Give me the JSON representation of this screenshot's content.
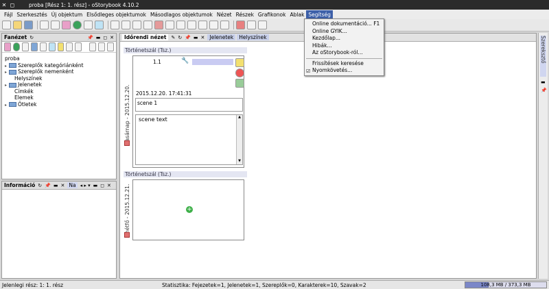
{
  "window": {
    "title": "proba [Rész 1: 1. rész] - oStorybook 4.10.2",
    "close_glyph": "✕",
    "restore_glyph": "◻"
  },
  "menubar": [
    "Fájl",
    "Szerkesztés",
    "Új objektum",
    "Elsődleges objektumok",
    "Másodlagos objektumok",
    "Nézet",
    "Részek",
    "Grafikonok",
    "Ablak",
    "Segítség"
  ],
  "help_menu": {
    "items": [
      "Online dokumentáció... F1",
      "Online GYIK...",
      "Kezdőlap...",
      "Hibák...",
      "Az oStorybook-ról..."
    ],
    "items2": [
      "Frissítések keresése",
      "Nyomkövetés..."
    ],
    "checked": "Nyomkövetés..."
  },
  "left_panel": {
    "title": "Fanézet",
    "tree": [
      "proba",
      "Szereplők kategóriánként",
      "Szereplők nemenként",
      "Helyszínek",
      "Jelenetek",
      "Címkék",
      "Elemek",
      "Ötletek"
    ]
  },
  "info_panel": {
    "title": "Információ",
    "tab": "Na"
  },
  "center": {
    "title": "Időrendi nézet",
    "tabs": [
      "Jelenetek",
      "Helyszínek"
    ],
    "strand1": "Történetszál (Tsz.)",
    "strand2": "Történetszál (Tsz.)",
    "card": {
      "number": "1.1",
      "date": "2015.12.20. 17:41:31",
      "title": "scene 1",
      "text": "scene text",
      "vdate": "vasárnap - 2015.12.20."
    },
    "card2": {
      "vdate": "hétfő - 2015.12.21."
    }
  },
  "right_sidebar": {
    "label": "Szereksztő"
  },
  "status": {
    "left": "Jelenlegi rész: 1: 1. rész",
    "stats": "Statisztika: Fejezetek=1, Jelenetek=1, Szereplők=0, Karakterek=10, Szavak=2",
    "memory": "108,3 MB / 373,3 MB",
    "memory_fraction": 0.29
  },
  "colors": {
    "menu_active": "#3c5fa8",
    "strand_label_bg": "#e4e6f2",
    "memory_bar": "#7b87c8"
  }
}
